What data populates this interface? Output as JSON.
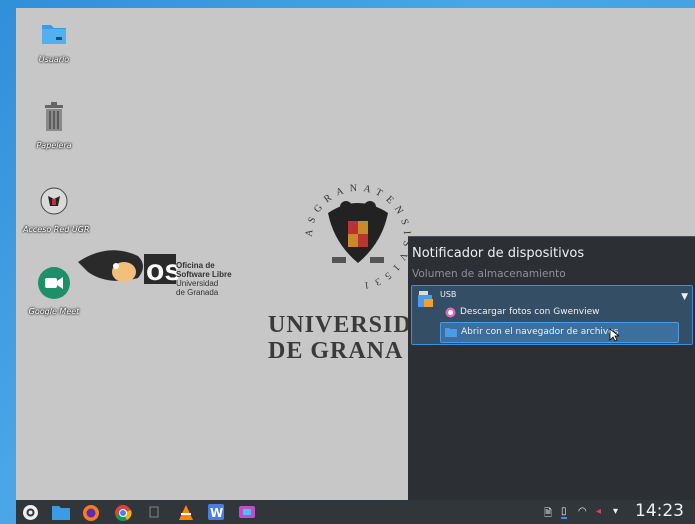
{
  "desktop": {
    "icons": [
      {
        "label": "Usuario"
      },
      {
        "label": "Papelera"
      },
      {
        "label": "Acceso Red UGR"
      },
      {
        "label": "Google Meet"
      }
    ],
    "wallpaper": {
      "university_line1": "UNIVERSID",
      "university_line2": "DE GRANA",
      "seal_text": "ASGRANATENSISV1531",
      "osl_mark": "osl",
      "osl_line1": "Oficina de",
      "osl_line2": "Software Libre",
      "osl_line3": "Universidad",
      "osl_line4": "de Granada"
    }
  },
  "notifier": {
    "title": "Notificador de dispositivos",
    "section": "Volumen de almacenamiento",
    "device": {
      "name": "USB",
      "actions": [
        {
          "label": "Descargar fotos con Gwenview"
        },
        {
          "label": "Abrir con el navegador de archivos"
        }
      ]
    }
  },
  "taskbar": {
    "clock": "14:23",
    "apps": [
      "application-launcher-icon",
      "dolphin-icon",
      "firefox-icon",
      "chrome-icon",
      "disk-icon",
      "vlc-icon",
      "writer-icon",
      "screenshot-icon"
    ]
  },
  "colors": {
    "panel_bg": "#31363b",
    "popup_bg": "#2c3035",
    "highlight": "#3d8ee0",
    "desktop_bg": "#c7c7c7"
  }
}
